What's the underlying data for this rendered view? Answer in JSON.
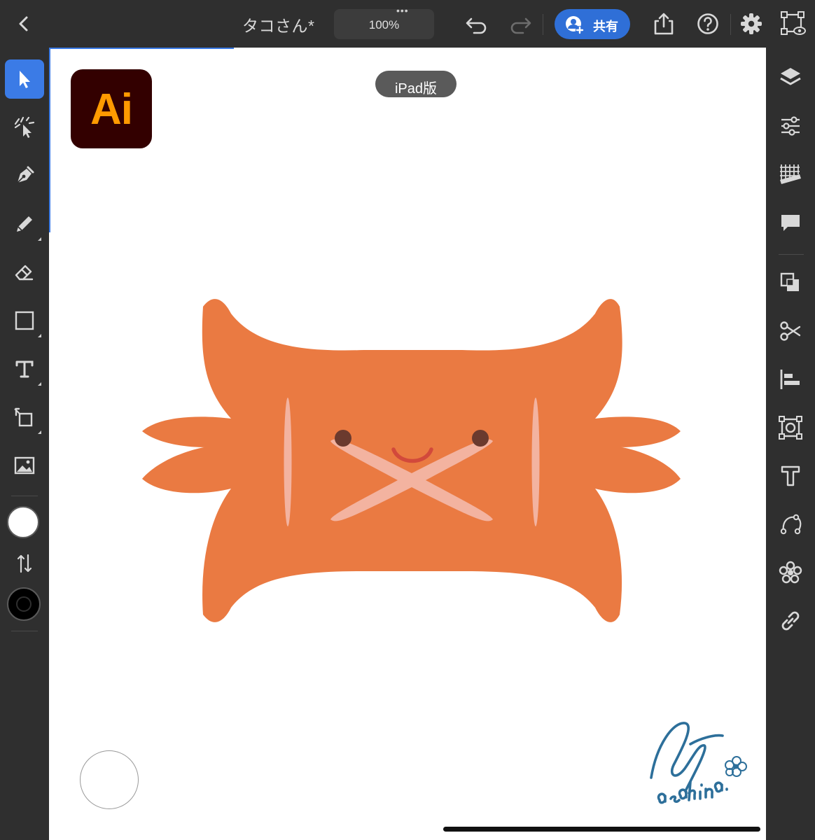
{
  "topbar": {
    "title": "タコさん*",
    "zoom": "100%",
    "zoom_menu_dots": "•••",
    "share_label": "共有"
  },
  "canvas": {
    "logo_text": "Ai",
    "badge_text": "iPad版",
    "signature_text": "asahina."
  },
  "colors": {
    "accent": "#3b7be6",
    "share_button": "#2f6fd7",
    "octopus_body": "#ea7a42",
    "octopus_highlight": "#f3b3a0",
    "octopus_eyes": "#6b3a2e",
    "octopus_mouth": "#d2493b",
    "logo_bg": "#330000",
    "logo_text": "#ff9a00"
  },
  "tools": {
    "left": [
      "selection-tool",
      "direct-selection-tool",
      "pen-tool",
      "pencil-tool",
      "eraser-tool",
      "rectangle-tool",
      "type-tool",
      "transform-tool",
      "place-image-tool",
      "fill-swatch",
      "swap-fill-stroke",
      "stroke-swatch"
    ],
    "right": [
      "layers-icon",
      "properties-icon",
      "grid-ruler-icon",
      "comment-icon",
      "pathfinder-icon",
      "scissors-icon",
      "align-icon",
      "repeat-icon",
      "type-panel-icon",
      "path-icon",
      "symbols-icon",
      "link-icon"
    ]
  }
}
